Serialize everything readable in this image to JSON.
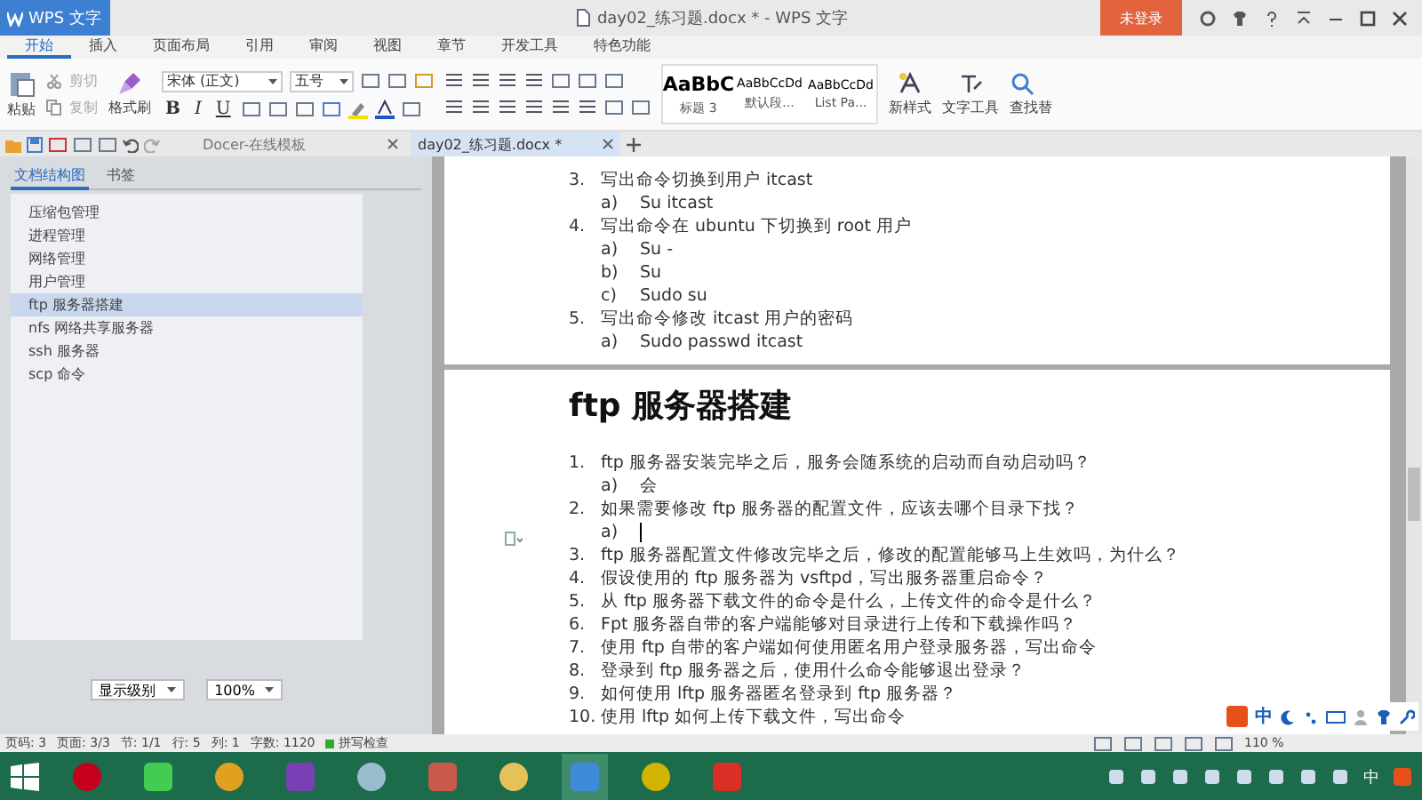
{
  "app_menu": "WPS 文字",
  "window": {
    "title": "day02_练习题.docx * - WPS 文字",
    "login": "未登录"
  },
  "ribbon_tabs": [
    {
      "label": "开始",
      "selected": true
    },
    {
      "label": "插入",
      "selected": false
    },
    {
      "label": "页面布局",
      "selected": false
    },
    {
      "label": "引用",
      "selected": false
    },
    {
      "label": "审阅",
      "selected": false
    },
    {
      "label": "视图",
      "selected": false
    },
    {
      "label": "章节",
      "selected": false
    },
    {
      "label": "开发工具",
      "selected": false
    },
    {
      "label": "特色功能",
      "selected": false
    }
  ],
  "ribbon": {
    "paste": "粘贴",
    "cut": "剪切",
    "copy": "复制",
    "format_painter": "格式刷",
    "font_name": "宋体 (正文)",
    "font_size": "五号",
    "format_buttons": [
      "B",
      "I",
      "U"
    ],
    "styles": [
      {
        "preview": "AaBbC",
        "name": "标题 3",
        "kind": "heading"
      },
      {
        "preview": "AaBbCcDd",
        "name": "默认段...",
        "kind": "body"
      },
      {
        "preview": "AaBbCcDd",
        "name": "List Pa...",
        "kind": "body"
      }
    ],
    "new_style": "新样式",
    "text_tools": "文字工具",
    "find": "查找替"
  },
  "doc_tabs": [
    {
      "label": "Docer-在线模板",
      "selected": false
    },
    {
      "label": "day02_练习题.docx *",
      "selected": true
    }
  ],
  "sidebar": {
    "tabs": [
      {
        "label": "文档结构图",
        "selected": true
      },
      {
        "label": "书签",
        "selected": false
      }
    ],
    "items": [
      {
        "label": "压缩包管理",
        "selected": false
      },
      {
        "label": "进程管理",
        "selected": false
      },
      {
        "label": "网络管理",
        "selected": false
      },
      {
        "label": "用户管理",
        "selected": false
      },
      {
        "label": "ftp 服务器搭建",
        "selected": true
      },
      {
        "label": "nfs 网络共享服务器",
        "selected": false
      },
      {
        "label": "ssh 服务器",
        "selected": false
      },
      {
        "label": "scp 命令",
        "selected": false
      }
    ],
    "level_select": "显示级别",
    "zoom_select": "100%"
  },
  "page_1": {
    "items": [
      {
        "number": "3.",
        "text": "写出命令切换到用户 itcast",
        "subs": [
          {
            "label": "a)",
            "text": "Su itcast"
          }
        ]
      },
      {
        "number": "4.",
        "text": "写出命令在 ubuntu 下切换到 root 用户",
        "subs": [
          {
            "label": "a)",
            "text": "Su -"
          },
          {
            "label": "b)",
            "text": "Su"
          },
          {
            "label": "c)",
            "text": "Sudo su"
          }
        ]
      },
      {
        "number": "5.",
        "text": "写出命令修改 itcast 用户的密码",
        "subs": [
          {
            "label": "a)",
            "text": "Sudo passwd itcast"
          }
        ]
      }
    ]
  },
  "page_2": {
    "heading": "ftp 服务器搭建",
    "items": [
      {
        "number": "1.",
        "text": "ftp 服务器安装完毕之后，服务会随系统的启动而自动启动吗？",
        "subs": [
          {
            "label": "a)",
            "text": "会"
          }
        ]
      },
      {
        "number": "2.",
        "text": "如果需要修改 ftp 服务器的配置文件，应该去哪个目录下找？",
        "subs": [
          {
            "label": "a)",
            "cursor": true
          }
        ]
      },
      {
        "number": "3.",
        "text": "ftp 服务器配置文件修改完毕之后，修改的配置能够马上生效吗，为什么？"
      },
      {
        "number": "4.",
        "text": "假设使用的 ftp 服务器为 vsftpd，写出服务器重启命令？"
      },
      {
        "number": "5.",
        "text": "从 ftp 服务器下载文件的命令是什么，上传文件的命令是什么？"
      },
      {
        "number": "6.",
        "text": "Fpt 服务器自带的客户端能够对目录进行上传和下载操作吗？"
      },
      {
        "number": "7.",
        "text": "使用 ftp 自带的客户端如何使用匿名用户登录服务器，写出命令"
      },
      {
        "number": "8.",
        "text": "登录到 ftp 服务器之后，使用什么命令能够退出登录？"
      },
      {
        "number": "9.",
        "text": "如何使用 lftp 服务器匿名登录到 ftp 服务器？"
      },
      {
        "number": "10.",
        "text": "使用 lftp 如何上传下载文件，写出命令"
      }
    ]
  },
  "ime": {
    "label": "中"
  },
  "status_bar": {
    "fields": [
      "页码: 3",
      "页面: 3/3",
      "节: 1/1",
      "行: 5",
      "列: 1",
      "字数: 1120"
    ],
    "spell_check": "拼写检查",
    "zoom": "110 %"
  },
  "taskbar": {
    "tray_label": "中"
  }
}
